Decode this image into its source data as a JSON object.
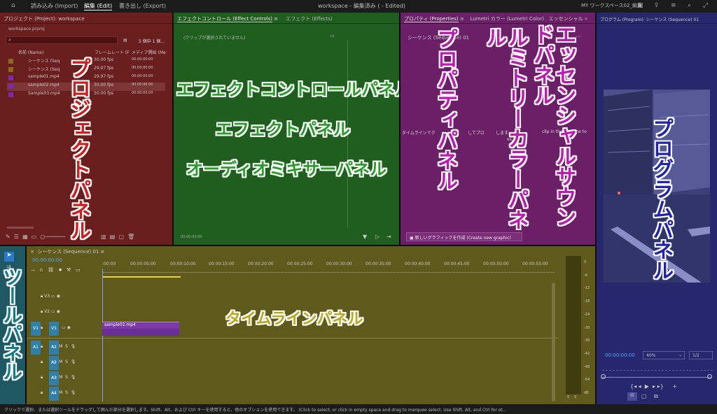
{
  "topbar": {
    "import": "読み込み (Import)",
    "edit": "編集 (Edit)",
    "export": "書き出し (Export)",
    "title": "workspace - 編集済み ( - Edited)",
    "workspace": "MY ワークスペース02_編集"
  },
  "project": {
    "title": "プロジェクト (Project): workspace",
    "file": "workspace.prproj",
    "count": "5 個中 1 個...",
    "col_name": "名前 (Name)",
    "col_rate": "フレームレート (F",
    "col_start": "メディア開始 (Me",
    "items": [
      {
        "name": "シーケンス (Seq",
        "rate": "30.00 fps",
        "start": "00:00:00:00"
      },
      {
        "name": "シーケンス (Seq",
        "rate": "29.97 fps",
        "start": "00;00;00;00"
      },
      {
        "name": "sample01.mp4",
        "rate": "29.97 fps",
        "start": "00:00:00:00"
      },
      {
        "name": "sample02.mp4",
        "rate": "30.00 fps",
        "start": "00:00:00:00"
      },
      {
        "name": "Sample03.mp4",
        "rate": "50.00 fps",
        "start": "00:00:00:00"
      }
    ],
    "label": "プロジェクトパネル"
  },
  "effects": {
    "tab1": "エフェクトコントロール (Effect Controls)",
    "tab2": "エフェクト (Effects)",
    "noclip": "(クリップが選択されていません)",
    "time": "00:00:00:00",
    "label1": "エフェクトコントロールパネル",
    "label2": "エフェクトパネル",
    "label3": "オーディオミキサーパネル"
  },
  "props": {
    "tab1": "プロパティ (Properties)",
    "tab2": "Lumetri カラー (Lumetri Color)",
    "tab3": "エッセンシャル",
    "seq": "シーケンス (Sequence) 01",
    "hint1": "タイムラインでク",
    "hint2": "してプロ",
    "hint3": "します。 (S",
    "hint4": "clip in the timeline to",
    "hint5": "es.)",
    "newgraphic": "新しいグラフィックを作成 (Create new graphic)",
    "label1": "プロパティパネル",
    "label2": "ルミトリーカラーパネル",
    "label3": "エッセンシャルサウンドパネル"
  },
  "program": {
    "title": "プログラム (Program): シーケンス (Sequence) 01",
    "time": "00:00:00:00",
    "zoom": "40%",
    "res": "1/2",
    "label": "プログラムパネル"
  },
  "timeline": {
    "title": "シーケンス (Sequence) 01",
    "time": "00:00:00:00",
    "ruler": [
      ":00:00",
      "00:00:05:00",
      "00:00:10:00",
      "00:00:15:00",
      "00:00:20:00",
      "00:00:25:00",
      "00:00:30:00",
      "00:00:35:00",
      "00:00:40:00",
      "00:00:45:00",
      "00:00:50:00",
      "00:00:55:00"
    ],
    "vtracks": [
      "V3",
      "V2",
      "V1"
    ],
    "atracks": [
      "A1",
      "A2",
      "A3",
      "A4"
    ],
    "src_v": "V1",
    "src_a": "A1",
    "clip": "sample02.mp4",
    "label": "タイムラインパネル"
  },
  "meter": {
    "ticks": [
      "0",
      "-6",
      "-12",
      "-18",
      "-24",
      "-30",
      "-36",
      "-42",
      "-48",
      "-54",
      "dB"
    ],
    "s1": "S",
    "s2": "S"
  },
  "tools": {
    "label": "ツールパネル"
  },
  "status": "クリックで選択、または選択ツールをドラッグして囲んだ部分を選択します。Shift、Alt、および Ctrl キーを使用すると、他のオプションを使用できます。 (Click to select, or click in empty space and drag to marquee select. Use Shift, Alt, and Ctrl for ot...",
  "colors": {
    "project": "#6b1e1e",
    "effects": "#1f5e1f",
    "props": "#6a1f66",
    "program": "#27276e",
    "timeline": "#5f5a1c",
    "tools": "#1f5863"
  }
}
